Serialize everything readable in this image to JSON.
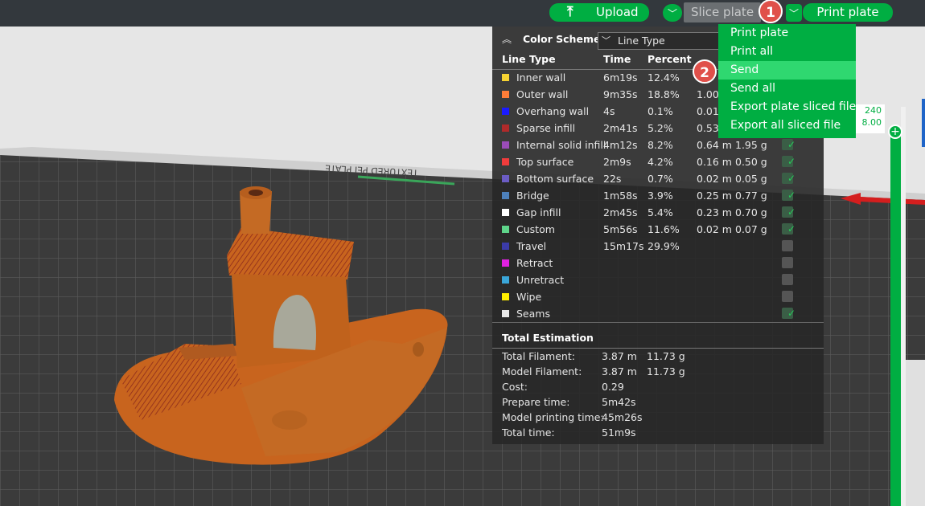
{
  "toolbar": {
    "upload_label": "Upload",
    "slice_label": "Slice plate",
    "print_label": "Print plate"
  },
  "legend": {
    "title": "Color Scheme",
    "scheme_value": "Line Type",
    "headers": {
      "type": "Line Type",
      "time": "Time",
      "percent": "Percent"
    },
    "rows": [
      {
        "name": "Inner wall",
        "color": "#f5d232",
        "time": "6m19s",
        "percent": "12.4%",
        "length": "",
        "weight": "",
        "checked": true
      },
      {
        "name": "Outer wall",
        "color": "#ff7d38",
        "time": "9m35s",
        "percent": "18.8%",
        "length": "1.00",
        "weight": "",
        "checked": true
      },
      {
        "name": "Overhang wall",
        "color": "#1a1aff",
        "time": "4s",
        "percent": "0.1%",
        "length": "0.01",
        "weight": "",
        "checked": true
      },
      {
        "name": "Sparse infill",
        "color": "#b02a2a",
        "time": "2m41s",
        "percent": "5.2%",
        "length": "0.53",
        "weight": "",
        "checked": true
      },
      {
        "name": "Internal solid infill",
        "color": "#9a4cb8",
        "time": "4m12s",
        "percent": "8.2%",
        "length": "0.64 m",
        "weight": "1.95 g",
        "checked": true
      },
      {
        "name": "Top surface",
        "color": "#f03c3c",
        "time": "2m9s",
        "percent": "4.2%",
        "length": "0.16 m",
        "weight": "0.50 g",
        "checked": true
      },
      {
        "name": "Bottom surface",
        "color": "#6b5cc4",
        "time": "22s",
        "percent": "0.7%",
        "length": "0.02 m",
        "weight": "0.05 g",
        "checked": true
      },
      {
        "name": "Bridge",
        "color": "#4d80ba",
        "time": "1m58s",
        "percent": "3.9%",
        "length": "0.25 m",
        "weight": "0.77 g",
        "checked": true
      },
      {
        "name": "Gap infill",
        "color": "#ffffff",
        "time": "2m45s",
        "percent": "5.4%",
        "length": "0.23 m",
        "weight": "0.70 g",
        "checked": true
      },
      {
        "name": "Custom",
        "color": "#5ed48a",
        "time": "5m56s",
        "percent": "11.6%",
        "length": "0.02 m",
        "weight": "0.07 g",
        "checked": true
      },
      {
        "name": "Travel",
        "color": "#3b3ba8",
        "time": "15m17s",
        "percent": "29.9%",
        "length": "",
        "weight": "",
        "checked": false
      },
      {
        "name": "Retract",
        "color": "#e020e0",
        "time": "",
        "percent": "",
        "length": "",
        "weight": "",
        "checked": false
      },
      {
        "name": "Unretract",
        "color": "#3aa6d8",
        "time": "",
        "percent": "",
        "length": "",
        "weight": "",
        "checked": false
      },
      {
        "name": "Wipe",
        "color": "#ffee00",
        "time": "",
        "percent": "",
        "length": "",
        "weight": "",
        "checked": false
      },
      {
        "name": "Seams",
        "color": "#e8e8e8",
        "time": "",
        "percent": "",
        "length": "",
        "weight": "",
        "checked": true
      }
    ],
    "summary_title": "Total Estimation",
    "summary": [
      {
        "label": "Total Filament:",
        "value": "3.87 m",
        "value2": "11.73 g"
      },
      {
        "label": "Model Filament:",
        "value": "3.87 m",
        "value2": "11.73 g"
      },
      {
        "label": "Cost:",
        "value": "0.29",
        "value2": ""
      },
      {
        "label": "Prepare time:",
        "value": "5m42s",
        "value2": ""
      },
      {
        "label": "Model printing time:",
        "value": "45m26s",
        "value2": ""
      },
      {
        "label": "Total time:",
        "value": "51m9s",
        "value2": ""
      }
    ]
  },
  "dropdown": {
    "items": [
      "Print plate",
      "Print all",
      "Send",
      "Send all",
      "Export plate sliced file",
      "Export all sliced file"
    ],
    "highlighted_index": 2
  },
  "badges": {
    "step1": "1",
    "step2": "2"
  },
  "slider": {
    "top_value": "240",
    "bottom_value": "8.00"
  },
  "plate_label": "TEXTURED PEI PLATE",
  "colors": {
    "accent": "#00ae42",
    "badge": "#e0504a",
    "model": "#c8641e"
  }
}
